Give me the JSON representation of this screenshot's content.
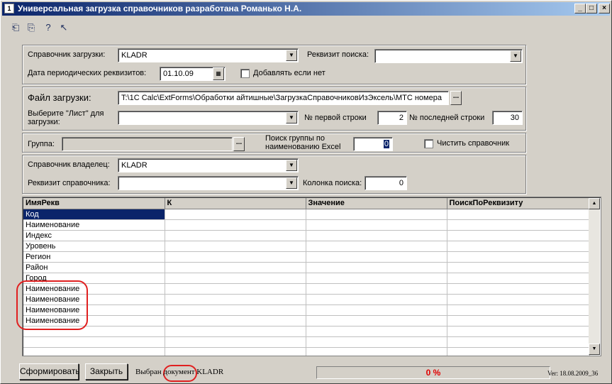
{
  "window": {
    "title": "Универсальная загрузка справочников разработана Романько Н.А.",
    "controls": [
      "_",
      "□",
      "×"
    ]
  },
  "toolbar": {
    "icons": [
      "open-icon",
      "save-icon",
      "help-icon",
      "pointer-help-icon"
    ],
    "glyphs": [
      "⎗",
      "⎘",
      "?",
      "↖"
    ]
  },
  "section1": {
    "catalog_label": "Справочник загрузки:",
    "catalog_value": "KLADR",
    "search_attr_label": "Реквизит поиска:",
    "search_attr_value": "",
    "date_label": "Дата периодических реквизитов:",
    "date_value": "01.10.09",
    "add_if_missing_label": "Добавлять если нет"
  },
  "section2": {
    "file_label": "Файл загрузки:",
    "file_value": "T:\\1C Calc\\ExtForms\\Обработки айтишные\\ЗагрузкаСправочниковИзЭксель\\МТС номера",
    "sheet_label": "Выберите \"Лист\" для загрузки:",
    "sheet_value": "",
    "first_row_label": "№ первой строки",
    "first_row_value": "2",
    "last_row_label": "№ последней строки",
    "last_row_value": "30"
  },
  "section3": {
    "group_label": "Группа:",
    "group_value": "",
    "search_group_label": "Поиск группы по наименованию Excel",
    "search_group_value": "0",
    "clear_catalog_label": "Чистить справочник"
  },
  "section4": {
    "owner_label": "Справочник владелец:",
    "owner_value": "KLADR",
    "attr_label": "Реквизит справочника:",
    "attr_value": "",
    "search_col_label": "Колонка поиска:",
    "search_col_value": "0"
  },
  "grid": {
    "columns": [
      "ИмяРекв",
      "К",
      "Значение",
      "ПоискПоРеквизиту"
    ],
    "rows": [
      "Код",
      "Наименование",
      "Индекс",
      "Уровень",
      "Регион",
      "Район",
      "Город",
      "Наименование",
      "Наименование",
      "Наименование",
      "Наименование",
      "",
      "",
      ""
    ]
  },
  "footer": {
    "generate_button": "Сформировать",
    "close_button": "Закрыть",
    "status_text": "Выбран документ KLADR",
    "progress_text": "0 %",
    "progress_value": 0,
    "version": "Ver: 18.08.2009_36"
  },
  "colors": {
    "title_start": "#0a246a",
    "title_end": "#a6caf0",
    "annotation": "#e02020",
    "progress_text": "#e00000"
  }
}
